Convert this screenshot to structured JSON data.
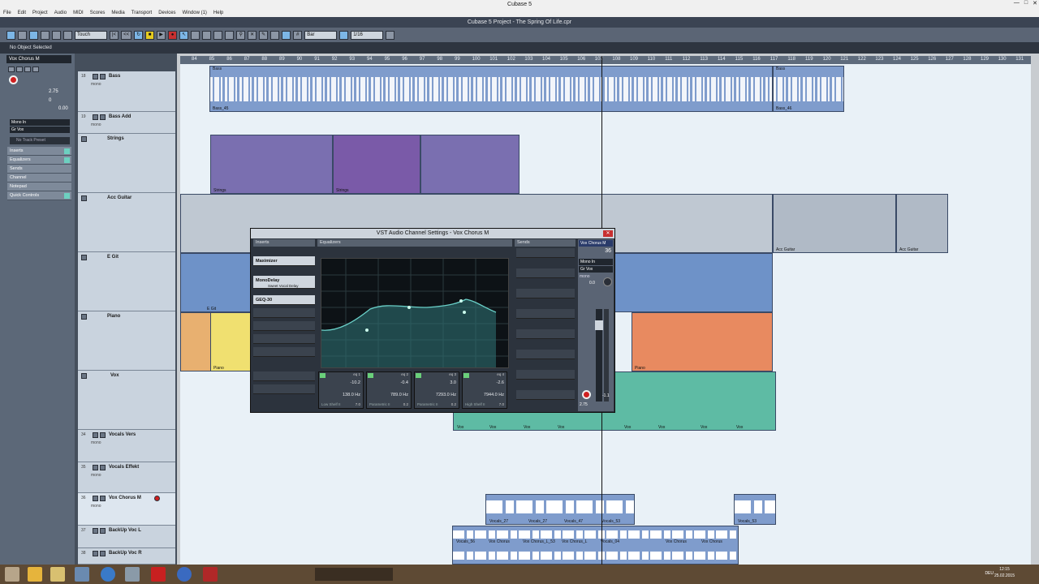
{
  "window": {
    "title": "Cubase 5",
    "project_title": "Cubase 5 Project - The Spring Of Life.cpr",
    "info": "No Object Selected"
  },
  "menu": [
    "File",
    "Edit",
    "Project",
    "Audio",
    "MIDI",
    "Scores",
    "Media",
    "Transport",
    "Devices",
    "Window (1)",
    "Help"
  ],
  "toolbar": {
    "automation_mode": "Touch",
    "grid_type": "Bar",
    "quantize": "1/16"
  },
  "inspector": {
    "track_name": "Vox Chorus M",
    "volume": "2.75",
    "pan": "0",
    "delay": "0.00",
    "input": "Mono In",
    "output": "Gr Vox",
    "preset": "No Track Preset",
    "sections": [
      "Inserts",
      "Equalizers",
      "Sends",
      "Channel",
      "Notepad",
      "Quick Controls"
    ]
  },
  "tracks": [
    {
      "num": "18",
      "name": "Bass",
      "sub": "mono"
    },
    {
      "num": "19",
      "name": "Bass Add",
      "sub": "mono"
    },
    {
      "num": "",
      "name": "Strings",
      "sub": ""
    },
    {
      "num": "",
      "name": "Acc Guitar",
      "sub": ""
    },
    {
      "num": "",
      "name": "E Git",
      "sub": ""
    },
    {
      "num": "",
      "name": "Piano",
      "sub": ""
    },
    {
      "num": "",
      "name": "Vox",
      "sub": ""
    },
    {
      "num": "34",
      "name": "Vocals Vers",
      "sub": "mono"
    },
    {
      "num": "35",
      "name": "Vocals Effekt",
      "sub": "mono"
    },
    {
      "num": "36",
      "name": "Vox Chorus M",
      "sub": "mono"
    },
    {
      "num": "37",
      "name": "BackUp Voc L",
      "sub": "mono"
    },
    {
      "num": "38",
      "name": "BackUp Voc R",
      "sub": "mono"
    }
  ],
  "ruler": [
    "84",
    "85",
    "86",
    "87",
    "88",
    "89",
    "90",
    "91",
    "92",
    "93",
    "94",
    "95",
    "96",
    "97",
    "98",
    "99",
    "100",
    "101",
    "102",
    "103",
    "104",
    "105",
    "106",
    "107",
    "108",
    "109",
    "110",
    "111",
    "112",
    "113",
    "114",
    "115",
    "116",
    "117",
    "118",
    "119",
    "120",
    "121",
    "122",
    "123",
    "124",
    "125",
    "126",
    "127",
    "128",
    "129",
    "130",
    "131"
  ],
  "events": {
    "bass_a": "Bass",
    "bass_a_low": "Bass_45",
    "bass_b": "Bass",
    "bass_b_low": "Bass_46",
    "strings_1": "Strings",
    "strings_2": "Strings",
    "acc_1": "Acc Guitar",
    "acc_2": "Acc Guitar",
    "egit": "E Git",
    "piano_1": "Piano",
    "piano_2": "Piano",
    "vox": [
      "Vox",
      "Vox",
      "Vox",
      "Vox",
      "Vox",
      "Vox",
      "Vox",
      "Vox"
    ],
    "vocals_top": [
      "Vocals_27",
      "Vocals_27",
      "Vocals_47",
      "Vocals_53",
      "Vocals_53"
    ],
    "vocals_bottom": [
      "Vocals_56",
      "Vox Chorus",
      "Vox Chorus_L_53",
      "Vox Chorus_L",
      "Vocals_04",
      "Vox Chorus",
      "Vox Chorus"
    ]
  },
  "dialog": {
    "title": "VST Audio Channel Settings - Vox Chorus M",
    "sec_inserts": "Inserts",
    "sec_eq": "Equalizers",
    "sec_sends": "Sends",
    "inserts": [
      "Maximizer",
      "MonoDelay",
      "GEQ-30"
    ],
    "insert_sub": "Sweet Vocal Delay",
    "eq_bands": [
      {
        "head": "eq 1",
        "gain": "-10.2",
        "freq": "138.0 Hz",
        "type": "Low Shelf II",
        "q": "7.0"
      },
      {
        "head": "eq 2",
        "gain": "-0.4",
        "freq": "789.0 Hz",
        "type": "Parametric II",
        "q": "0.2"
      },
      {
        "head": "eq 3",
        "gain": "3.0",
        "freq": "7293.0 Hz",
        "type": "Parametric II",
        "q": "0.2"
      },
      {
        "head": "eq 4",
        "gain": "-2.6",
        "freq": "7944.0 Hz",
        "type": "High Shelf II",
        "q": "7.0"
      }
    ],
    "channel": {
      "name": "Vox Chorus M",
      "number": "36",
      "input": "Mono In",
      "output": "Gr Vox",
      "routing": "mono",
      "pan": "0.0",
      "fader": "2.75",
      "peak": "-1.1"
    }
  },
  "taskbar": {
    "time": "12:15",
    "date": "25.02.2015",
    "lang": "DEU"
  }
}
